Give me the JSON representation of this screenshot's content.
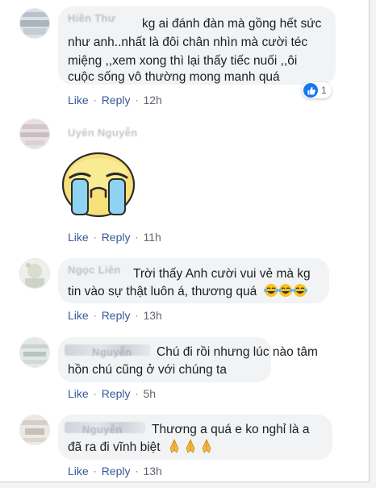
{
  "comments": [
    {
      "author": "Hiền Thư",
      "text": "kg ai đánh đàn mà gồng hết sức như anh..nhất là đôi chân nhìn mà cười téc miệng ,,xem xong thì lại thấy tiếc nuối ,,ôi cuộc sống vô thường mong manh quá",
      "line1": "kg ai đánh đàn mà gồng hết sức",
      "line2": "như anh..nhất là đôi chân nhìn mà cười téc",
      "line3": "miệng ,,xem xong thì lại thấy tiếc nuối ,,ôi",
      "line4": "cuộc sống vô thường mong manh quá",
      "reaction_count": "1",
      "like_label": "Like",
      "reply_label": "Reply",
      "time": "12h"
    },
    {
      "author": "Uyên Nguyễn",
      "sticker": "crying-face-sticker",
      "like_label": "Like",
      "reply_label": "Reply",
      "time": "11h"
    },
    {
      "author": "Ngọc Liên",
      "line1": "Trời thấy Anh cười vui vẻ mà kg",
      "line2": "tin vào sự thật luôn á, thương quá",
      "emojis": "tears-of-joy-emoji x3",
      "like_label": "Like",
      "reply_label": "Reply",
      "time": "13h"
    },
    {
      "author": "Nguyễn",
      "line1": "Chú đi rồi nhưng lúc nào tâm",
      "line2": "hồn chú cũng ở với chúng ta",
      "like_label": "Like",
      "reply_label": "Reply",
      "time": "5h"
    },
    {
      "author": "Nguyễn",
      "line1": "Thương a quá e ko nghỉ là a",
      "line2": "đã ra đi vĩnh biệt",
      "emojis": "folded-hands-emoji x3",
      "like_label": "Like",
      "reply_label": "Reply",
      "time": "13h"
    }
  ],
  "colors": {
    "link": "#385898",
    "bubble": "#f2f3f5",
    "meta": "#606770",
    "like_badge": "#1877f2"
  }
}
